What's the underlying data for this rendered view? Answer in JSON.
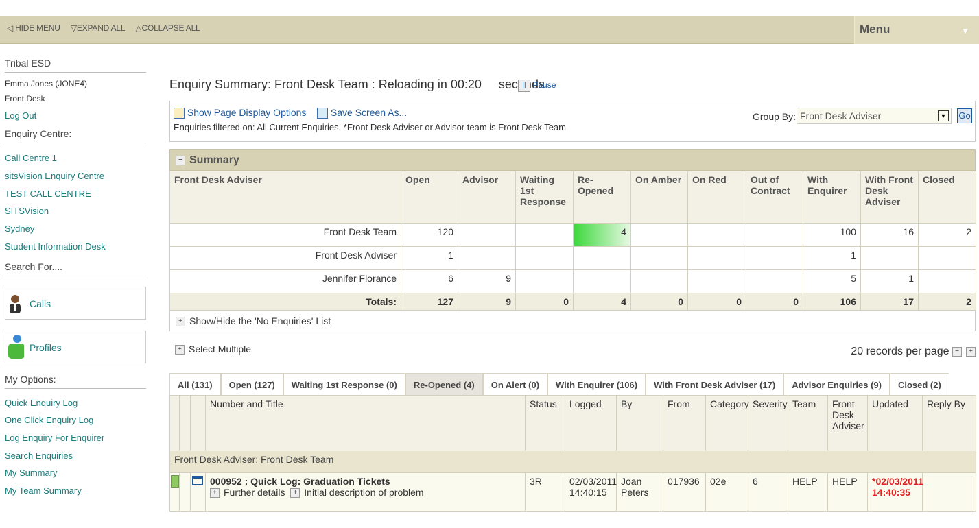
{
  "topbar": {
    "hide_menu": "HIDE MENU",
    "expand_all": "EXPAND ALL",
    "collapse_all": "COLLAPSE ALL",
    "menu": "Menu"
  },
  "sidebar": {
    "org": "Tribal ESD",
    "user": "Emma Jones (JONE4)",
    "role": "Front Desk",
    "logout": "Log Out",
    "centre_heading": "Enquiry Centre:",
    "centres": [
      "Call Centre 1",
      "sitsVision Enquiry Centre",
      "TEST CALL CENTRE",
      "SITSVision",
      "Sydney",
      "Student Information Desk"
    ],
    "search_heading": "Search For....",
    "calls": "Calls",
    "profiles": "Profiles",
    "options_heading": "My Options:",
    "options": [
      "Quick Enquiry Log",
      "One Click Enquiry Log",
      "Log Enquiry For Enquirer",
      "Search Enquiries",
      "My Summary",
      "My Team Summary"
    ]
  },
  "page": {
    "title": "Enquiry Summary: Front Desk Team : Reloading in  00:20",
    "seconds": "seconds",
    "pause": "Pause",
    "show_options": "Show Page Display Options",
    "save_screen": "Save Screen As...",
    "filter_text": "Enquiries filtered on: All Current Enquiries, *Front Desk Adviser or Advisor team is Front Desk Team",
    "group_by_label": "Group By:",
    "group_by_value": "Front Desk Adviser",
    "go": "Go"
  },
  "summary": {
    "caption": "Summary",
    "headers": [
      "Front Desk Adviser",
      "Open",
      "Advisor",
      "Waiting 1st Response",
      "Re-Opened",
      "On Amber",
      "On Red",
      "Out of Contract",
      "With Enquirer",
      "With Front Desk Adviser",
      "Closed"
    ],
    "rows": [
      [
        "Front Desk Team",
        "120",
        "",
        "",
        "4",
        "",
        "",
        "",
        "100",
        "16",
        "2"
      ],
      [
        "Front Desk Adviser",
        "1",
        "",
        "",
        "",
        "",
        "",
        "",
        "1",
        "",
        ""
      ],
      [
        "Jennifer Florance",
        "6",
        "9",
        "",
        "",
        "",
        "",
        "",
        "5",
        "1",
        ""
      ]
    ],
    "totals": [
      "Totals:",
      "127",
      "9",
      "0",
      "4",
      "0",
      "0",
      "0",
      "106",
      "17",
      "2"
    ]
  },
  "show_hide": "Show/Hide the 'No Enquiries' List",
  "select_multiple": "Select Multiple",
  "per_page": "20 records per page",
  "tabs": [
    "All (131)",
    "Open (127)",
    "Waiting 1st Response (0)",
    "Re-Opened (4)",
    "On Alert (0)",
    "With Enquirer (106)",
    "With Front Desk Adviser (17)",
    "Advisor Enquiries (9)",
    "Closed (2)"
  ],
  "list": {
    "headers": [
      "Number and Title",
      "Status",
      "Logged",
      "By",
      "From",
      "Category",
      "Severity",
      "Team",
      "Front Desk Adviser",
      "Updated",
      "Reply By"
    ],
    "group": "Front Desk Adviser: Front Desk Team",
    "row": {
      "title": "000952 : Quick Log: Graduation Tickets",
      "further": "Further details",
      "initial": "Initial description of problem",
      "status": "3R",
      "logged": "02/03/2011 14:40:15",
      "by": "Joan Peters",
      "from": "017936",
      "category": "02e",
      "severity": "6",
      "team": "HELP",
      "fda": "HELP",
      "updated": "*02/03/2011 14:40:35",
      "reply": ""
    }
  },
  "colors": {
    "accent": "#1a7b7b",
    "header": "#d8d2b4",
    "alert": "#e02020"
  }
}
